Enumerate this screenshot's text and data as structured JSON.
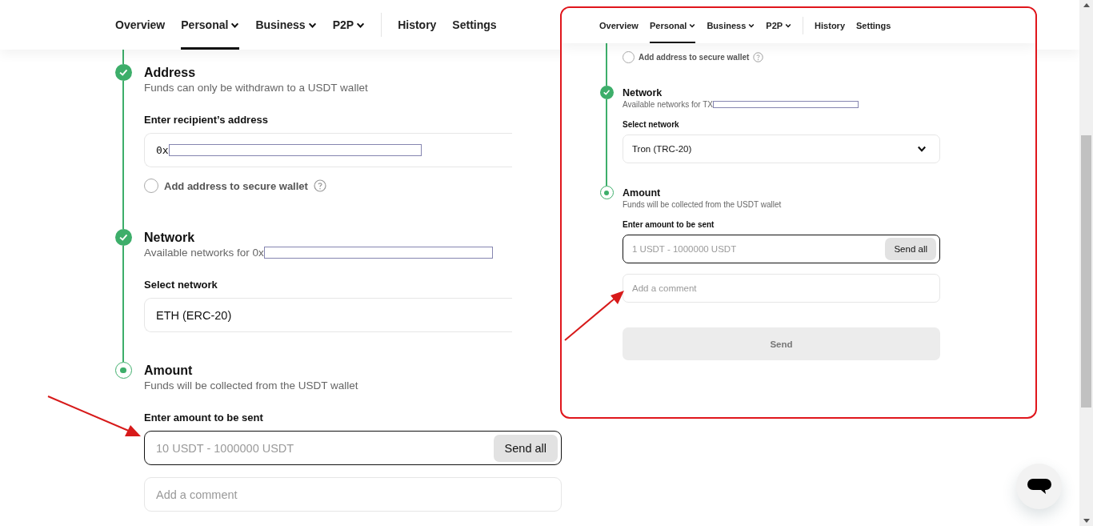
{
  "nav": {
    "items": [
      {
        "label": "Overview",
        "dropdown": false,
        "selected": false
      },
      {
        "label": "Personal",
        "dropdown": true,
        "selected": true
      },
      {
        "label": "Business",
        "dropdown": true,
        "selected": false
      },
      {
        "label": "P2P",
        "dropdown": true,
        "selected": false
      },
      {
        "label": "History",
        "dropdown": false,
        "selected": false,
        "divider_before": true
      },
      {
        "label": "Settings",
        "dropdown": false,
        "selected": false
      }
    ]
  },
  "steps": [
    {
      "title": "Address",
      "subtitle": "Funds can only be withdrawn to a USDT wallet",
      "completed": true,
      "fields": [
        {
          "kind": "text",
          "label": "Enter recipient’s address",
          "value": "0x",
          "redacted": true
        },
        {
          "kind": "checkbox",
          "label": "Add address to secure wallet",
          "checked": false
        }
      ]
    },
    {
      "title": "Network",
      "subtitle": "Available networks for 0x",
      "subtitle_redacted": true,
      "completed": true,
      "fields": [
        {
          "kind": "select",
          "label": "Select network",
          "value": "ETH (ERC-20)"
        }
      ]
    },
    {
      "title": "Amount",
      "subtitle": "Funds will be collected from the USDT wallet",
      "completed": false,
      "fields": [
        {
          "kind": "amount",
          "label": "Enter amount to be sent",
          "placeholder": "10 USDT - 1000000 USDT",
          "button": "Send all",
          "focused": true
        },
        {
          "kind": "comment",
          "placeholder": "Add a comment"
        }
      ]
    }
  ],
  "inset": {
    "nav": {
      "items": [
        {
          "label": "Overview",
          "dropdown": false,
          "selected": false
        },
        {
          "label": "Personal",
          "dropdown": true,
          "selected": true
        },
        {
          "label": "Business",
          "dropdown": true,
          "selected": false
        },
        {
          "label": "P2P",
          "dropdown": true,
          "selected": false
        },
        {
          "label": "History",
          "dropdown": false,
          "selected": false,
          "divider_before": true
        },
        {
          "label": "Settings",
          "dropdown": false,
          "selected": false
        }
      ]
    },
    "top_fields": [
      {
        "kind": "checkbox",
        "label": "Add address to secure wallet",
        "checked": false
      }
    ],
    "steps": [
      {
        "title": "Network",
        "subtitle": "Available networks for TX",
        "subtitle_redacted": true,
        "completed": true,
        "fields": [
          {
            "kind": "select",
            "label": "Select network",
            "value": "Tron (TRC-20)",
            "chevron": true
          }
        ]
      },
      {
        "title": "Amount",
        "subtitle": "Funds will be collected from the USDT wallet",
        "completed": false,
        "fields": [
          {
            "kind": "amount",
            "label": "Enter amount to be sent",
            "placeholder": "1 USDT - 1000000 USDT",
            "button": "Send all",
            "focused": true
          },
          {
            "kind": "comment",
            "placeholder": "Add a comment"
          }
        ]
      }
    ],
    "submit": {
      "label": "Send",
      "disabled": true
    }
  }
}
